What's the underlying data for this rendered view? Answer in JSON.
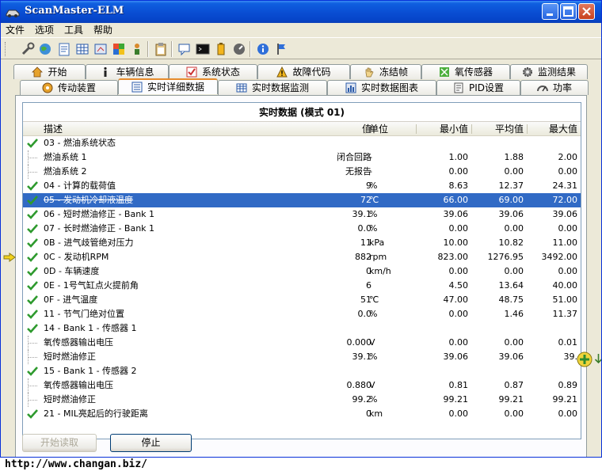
{
  "window": {
    "title": "ScanMaster-ELM"
  },
  "menu": [
    "文件",
    "选项",
    "工具",
    "帮助"
  ],
  "toolbar_icons": [
    "wrench-icon",
    "globe-icon",
    "document-icon",
    "grid-icon",
    "meter-icon",
    "chart-icon",
    "people-icon",
    "clipboard-icon",
    "chat-icon",
    "terminal-icon",
    "battery-icon",
    "gauge-icon",
    "info-icon",
    "flag-icon"
  ],
  "tabs_top": [
    {
      "label": "开始",
      "icon": "home-icon"
    },
    {
      "label": "车辆信息",
      "icon": "info-icon"
    },
    {
      "label": "系统状态",
      "icon": "checkbox-icon"
    },
    {
      "label": "故障代码",
      "icon": "warning-icon"
    },
    {
      "label": "冻结帧",
      "icon": "hand-icon"
    },
    {
      "label": "氧传感器",
      "icon": "sensor-icon"
    },
    {
      "label": "监测结果",
      "icon": "gear-icon"
    }
  ],
  "tabs_bottom": [
    {
      "label": "传动装置",
      "icon": "transmission-icon"
    },
    {
      "label": "实时详细数据",
      "icon": "list-icon",
      "active": true
    },
    {
      "label": "实时数据监测",
      "icon": "table-icon"
    },
    {
      "label": "实时数据图表",
      "icon": "chart-icon"
    },
    {
      "label": "PID设置",
      "icon": "settings-icon"
    },
    {
      "label": "功率",
      "icon": "power-icon"
    }
  ],
  "list": {
    "title": "实时数据 (模式 01)",
    "columns": {
      "desc": "描述",
      "value": "值",
      "unit": "单位",
      "min": "最小值",
      "avg": "平均值",
      "max": "最大值"
    },
    "rows": [
      {
        "desc": "03 - 燃油系统状态",
        "value": "",
        "unit": "",
        "min": "",
        "avg": "",
        "max": "",
        "check": true
      },
      {
        "desc": "燃油系统 1",
        "value": "闭合回路",
        "unit": "-",
        "min": "1.00",
        "avg": "1.88",
        "max": "2.00",
        "child": true
      },
      {
        "desc": "燃油系统 2",
        "value": "无报告",
        "unit": "-",
        "min": "0.00",
        "avg": "0.00",
        "max": "0.00",
        "child": true
      },
      {
        "desc": "04 - 计算的载荷值",
        "value": "9",
        "unit": "%",
        "min": "8.63",
        "avg": "12.37",
        "max": "24.31",
        "check": true
      },
      {
        "desc": "05 - 发动机冷却液温度",
        "value": "72",
        "unit": "℃",
        "min": "66.00",
        "avg": "69.00",
        "max": "72.00",
        "check": true,
        "selected": true
      },
      {
        "desc": "06 - 短时燃油修正 - Bank 1",
        "value": "39.1",
        "unit": "%",
        "min": "39.06",
        "avg": "39.06",
        "max": "39.06",
        "check": true
      },
      {
        "desc": "07 - 长时燃油修正 - Bank 1",
        "value": "0.0",
        "unit": "%",
        "min": "0.00",
        "avg": "0.00",
        "max": "0.00",
        "check": true
      },
      {
        "desc": "0B - 进气歧管绝对压力",
        "value": "11",
        "unit": "kPa",
        "min": "10.00",
        "avg": "10.82",
        "max": "11.00",
        "check": true
      },
      {
        "desc": "0C - 发动机RPM",
        "value": "882",
        "unit": "rpm",
        "min": "823.00",
        "avg": "1276.95",
        "max": "3492.00",
        "check": true,
        "pointer": true
      },
      {
        "desc": "0D - 车辆速度",
        "value": "0",
        "unit": "km/h",
        "min": "0.00",
        "avg": "0.00",
        "max": "0.00",
        "check": true
      },
      {
        "desc": "0E - 1号气缸点火提前角",
        "value": "6",
        "unit": "",
        "min": "4.50",
        "avg": "13.64",
        "max": "40.00",
        "check": true
      },
      {
        "desc": "0F - 进气温度",
        "value": "51",
        "unit": "℃",
        "min": "47.00",
        "avg": "48.75",
        "max": "51.00",
        "check": true
      },
      {
        "desc": "11 - 节气门绝对位置",
        "value": "0.0",
        "unit": "%",
        "min": "0.00",
        "avg": "1.46",
        "max": "11.37",
        "check": true
      },
      {
        "desc": "14 - Bank 1 - 传感器 1",
        "value": "",
        "unit": "",
        "min": "",
        "avg": "",
        "max": "",
        "check": true
      },
      {
        "desc": "氧传感器输出电压",
        "value": "0.000",
        "unit": "V",
        "min": "0.00",
        "avg": "0.00",
        "max": "0.01",
        "child": true
      },
      {
        "desc": "短时燃油修正",
        "value": "39.1",
        "unit": "%",
        "min": "39.06",
        "avg": "39.06",
        "max": "39.",
        "child": true
      },
      {
        "desc": "15 - Bank 1 - 传感器 2",
        "value": "",
        "unit": "",
        "min": "",
        "avg": "",
        "max": "",
        "check": true
      },
      {
        "desc": "氧传感器输出电压",
        "value": "0.880",
        "unit": "V",
        "min": "0.81",
        "avg": "0.87",
        "max": "0.89",
        "child": true
      },
      {
        "desc": "短时燃油修正",
        "value": "99.2",
        "unit": "%",
        "min": "99.21",
        "avg": "99.21",
        "max": "99.21",
        "child": true
      },
      {
        "desc": "21 - MIL亮起后的行驶距离",
        "value": "0",
        "unit": "km",
        "min": "0.00",
        "avg": "0.00",
        "max": "0.00",
        "check": true
      }
    ]
  },
  "buttons": {
    "start": "开始读取",
    "stop": "停止"
  },
  "url": "http://www.changan.biz/"
}
